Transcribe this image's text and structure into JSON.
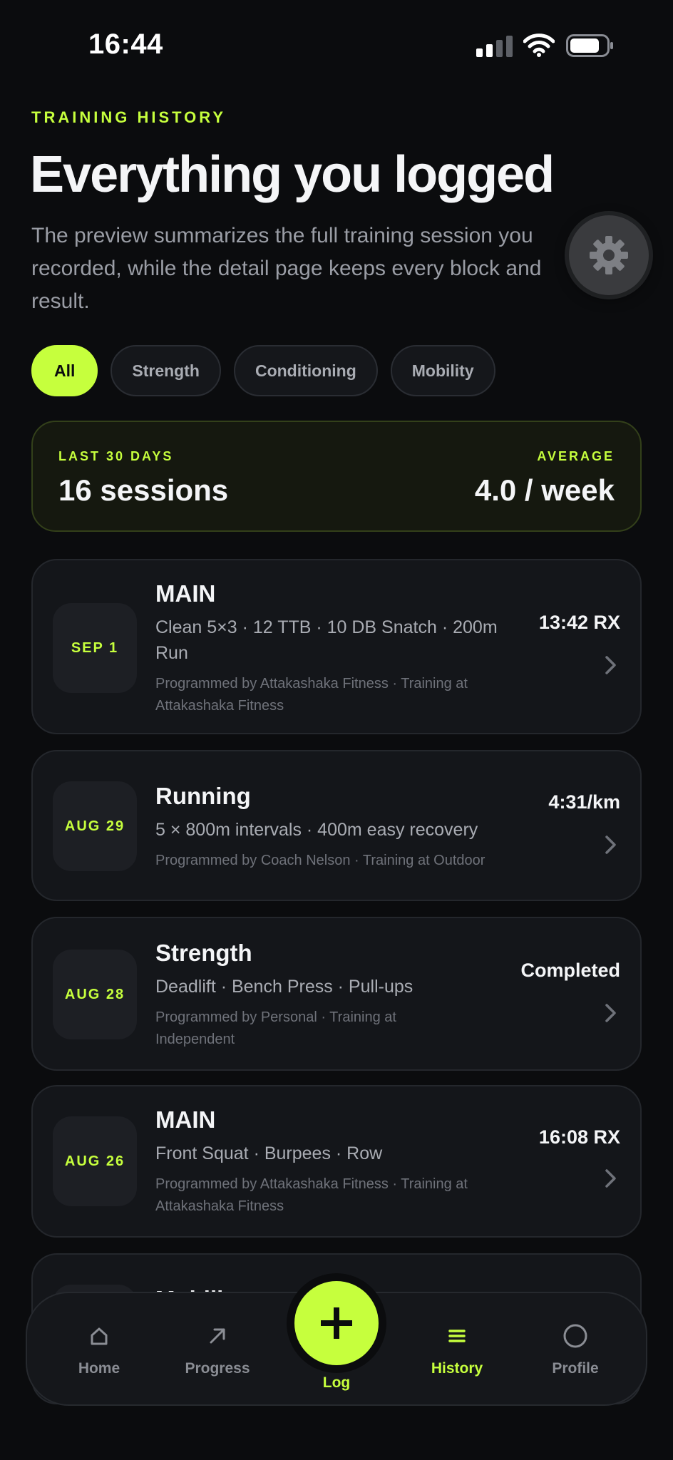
{
  "status_bar": {
    "time": "16:44"
  },
  "header": {
    "eyebrow": "TRAINING HISTORY",
    "title": "Everything you logged",
    "description": "The preview summarizes the full training session you recorded, while the detail page keeps every block and result."
  },
  "filters": [
    {
      "label": "All",
      "active": true
    },
    {
      "label": "Strength",
      "active": false
    },
    {
      "label": "Conditioning",
      "active": false
    },
    {
      "label": "Mobility",
      "active": false
    }
  ],
  "summary": {
    "left_label": "LAST 30 DAYS",
    "left_value": "16 sessions",
    "right_label": "AVERAGE",
    "right_value": "4.0 / week"
  },
  "sessions": [
    {
      "date": "SEP 1",
      "title": "MAIN",
      "description": "Clean 5×3 · 12 TTB · 10 DB Snatch · 200m Run",
      "meta": "Programmed by Attakashaka Fitness · Training at Attakashaka Fitness",
      "result": "13:42 RX"
    },
    {
      "date": "AUG 29",
      "title": "Running",
      "description": "5 × 800m intervals · 400m easy recovery",
      "meta": "Programmed by Coach Nelson · Training at Outdoor",
      "result": "4:31/km"
    },
    {
      "date": "AUG 28",
      "title": "Strength",
      "description": "Deadlift · Bench Press · Pull-ups",
      "meta": "Programmed by Personal · Training at Independent",
      "result": "Completed"
    },
    {
      "date": "AUG 26",
      "title": "MAIN",
      "description": "Front Squat · Burpees · Row",
      "meta": "Programmed by Attakashaka Fitness · Training at Attakashaka Fitness",
      "result": "16:08 RX"
    },
    {
      "date": "",
      "title": "Mobility",
      "description": "",
      "meta": "",
      "result": ""
    }
  ],
  "tabbar": {
    "items": [
      {
        "label": "Home",
        "icon": "home-icon",
        "active": false
      },
      {
        "label": "Progress",
        "icon": "arrow-up-right-icon",
        "active": false
      },
      {
        "label": "Log",
        "icon": "plus-icon",
        "active": false
      },
      {
        "label": "History",
        "icon": "list-icon",
        "active": true
      },
      {
        "label": "Profile",
        "icon": "profile-circle-icon",
        "active": false
      }
    ]
  },
  "colors": {
    "accent": "#c6ff3d",
    "background": "#0b0c0e",
    "card": "#14161a"
  }
}
